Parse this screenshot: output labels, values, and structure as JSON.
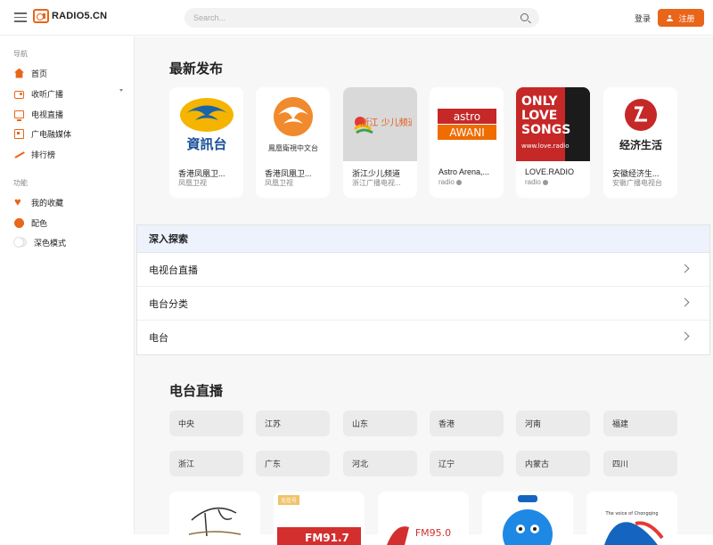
{
  "header": {
    "logo_text": "RADIO5.CN",
    "search_placeholder": "Search...",
    "login_label": "登录",
    "register_label": "注册"
  },
  "sidebar": {
    "nav_section": "导航",
    "nav_items": [
      {
        "label": "首页",
        "icon": "home-icon"
      },
      {
        "label": "收听广播",
        "icon": "radio-icon"
      },
      {
        "label": "电视直播",
        "icon": "tv-icon"
      },
      {
        "label": "广电融媒体",
        "icon": "media-icon"
      },
      {
        "label": "排行榜",
        "icon": "trend-icon"
      }
    ],
    "func_section": "功能",
    "func_items": [
      {
        "label": "我的收藏",
        "icon": "heart-icon"
      },
      {
        "label": "配色",
        "icon": "palette-icon"
      },
      {
        "label": "深色模式",
        "icon": "toggle-icon"
      }
    ]
  },
  "latest": {
    "title": "最新发布",
    "cards": [
      {
        "name": "香港凤凰卫...",
        "sub": "凤凰卫视",
        "logo": "資訊台"
      },
      {
        "name": "香港凤凰卫...",
        "sub": "凤凰卫视",
        "logo": "鳳凰衛視中文台"
      },
      {
        "name": "浙江少儿频道",
        "sub": "浙江广播电视...",
        "logo": "浙江 少儿频道"
      },
      {
        "name": "Astro Arena,...",
        "sub": "radio",
        "logo_top": "astro",
        "logo_bottom": "AWANI"
      },
      {
        "name": "LOVE.RADIO",
        "sub": "radio",
        "logo_lines": [
          "ONLY",
          "LOVE",
          "SONGS",
          "www.love.radio"
        ]
      },
      {
        "name": "安徽经济生...",
        "sub": "安徽广播电视台",
        "logo": "经济生活"
      }
    ]
  },
  "explore": {
    "title": "深入探索",
    "rows": [
      "电视台直播",
      "电台分类",
      "电台"
    ]
  },
  "live": {
    "title": "电台直播",
    "regions": [
      "中央",
      "江苏",
      "山东",
      "香港",
      "河南",
      "福建",
      "浙江",
      "广东",
      "河北",
      "辽宁",
      "内蒙古",
      "四川"
    ],
    "tag": "无信号",
    "card_texts": [
      "FM91.7",
      "FM95.0",
      "The voice of Chongqing"
    ]
  }
}
